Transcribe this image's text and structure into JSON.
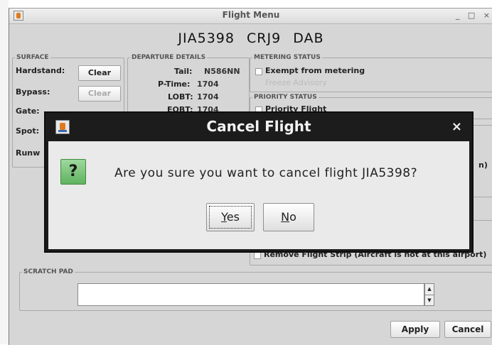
{
  "window": {
    "title": "Flight Menu",
    "controls": "_ □ ×"
  },
  "flight": {
    "callsign": "JIA5398",
    "aircraft_type": "CRJ9",
    "destination": "DAB"
  },
  "surface": {
    "legend": "SURFACE",
    "hardstand_label": "Hardstand:",
    "bypass_label": "Bypass:",
    "gate_label": "Gate:",
    "spot_label": "Spot:",
    "runway_label": "Runw",
    "clear_label": "Clear"
  },
  "departure": {
    "legend": "DEPARTURE DETAILS",
    "tail_label": "Tail:",
    "tail_value": "N586NN",
    "ptime_label": "P-Time:",
    "ptime_value": "1704",
    "lobt_label": "LOBT:",
    "lobt_value": "1704",
    "eobt_label": "EOBT:",
    "eobt_value": "1704"
  },
  "metering": {
    "legend": "METERING STATUS",
    "exempt_label": "Exempt from metering",
    "freeze_label": "Freeze Advisory"
  },
  "priority": {
    "legend": "PRIORITY STATUS",
    "priority_label": "Priority Flight"
  },
  "partial_right_text": "n)",
  "remove_strip_label": "Remove Flight Strip (Aircraft is not at this airport)",
  "scratch": {
    "legend": "SCRATCH PAD",
    "value": ""
  },
  "footer": {
    "apply_label": "Apply",
    "cancel_label": "Cancel"
  },
  "dialog": {
    "title": "Cancel Flight",
    "close_glyph": "×",
    "icon_glyph": "?",
    "message": "Are you sure you want to cancel flight JIA5398?",
    "yes_mnemonic": "Y",
    "yes_rest": "es",
    "no_mnemonic": "N",
    "no_rest": "o"
  }
}
